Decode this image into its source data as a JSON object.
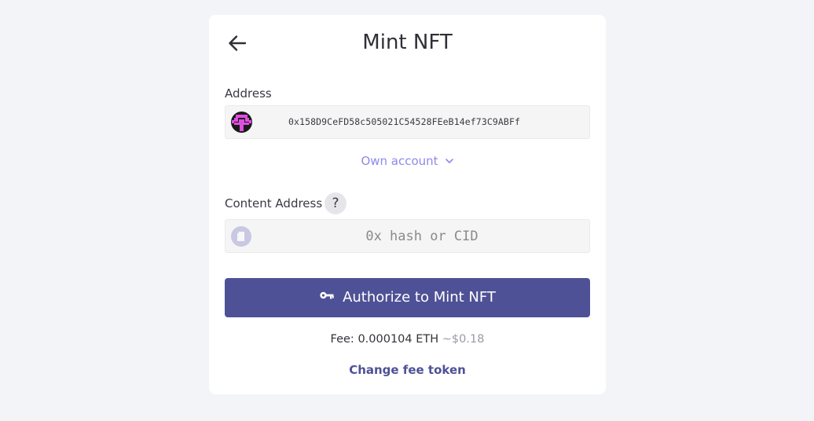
{
  "header": {
    "title": "Mint NFT",
    "back_icon": "arrow-left-icon"
  },
  "address": {
    "label": "Address",
    "value": "0x158D9CeFD58c505021C54528FEeB14ef73C9ABFf",
    "avatar_icon": "identicon-avatar"
  },
  "own_account": {
    "label": "Own account",
    "icon": "chevron-down-icon"
  },
  "content_address": {
    "label": "Content Address",
    "help_label": "?",
    "placeholder": "0x hash or CID",
    "value": ""
  },
  "authorize": {
    "label": "Authorize to Mint NFT",
    "icon": "key-icon"
  },
  "fee": {
    "label": "Fee:",
    "amount": "0.000104 ETH",
    "usd": "~$0.18"
  },
  "change_fee": {
    "label": "Change fee token"
  },
  "colors": {
    "primary": "#4f5196",
    "link": "#8c8ae8",
    "background": "#f3f4f8",
    "card": "#ffffff"
  }
}
